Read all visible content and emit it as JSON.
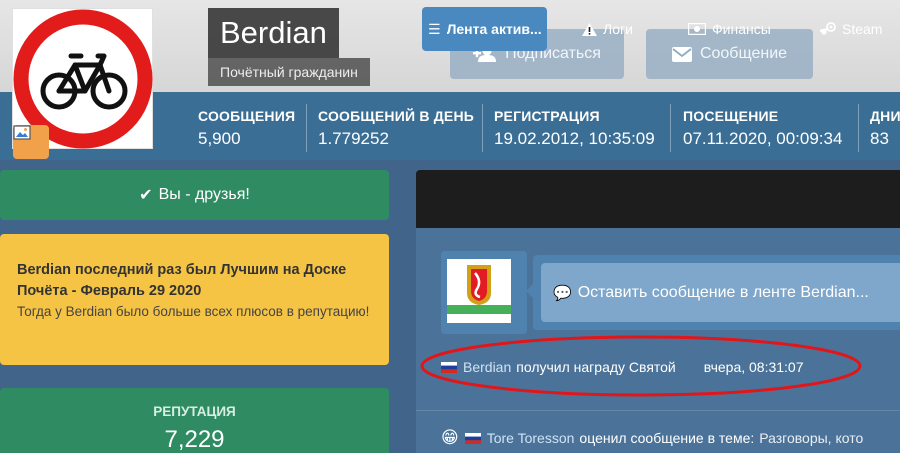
{
  "profile": {
    "name": "Berdian",
    "title": "Почётный гражданин",
    "follow_label": "Подписаться",
    "message_label": "Сообщение"
  },
  "stats": [
    {
      "label": "СООБЩЕНИЯ",
      "value": "5,900"
    },
    {
      "label": "СООБЩЕНИЙ В ДЕНЬ",
      "value": "1.779252"
    },
    {
      "label": "РЕГИСТРАЦИЯ",
      "value": "19.02.2012, 10:35:09"
    },
    {
      "label": "ПОСЕЩЕНИЕ",
      "value": "07.11.2020, 00:09:34"
    },
    {
      "label": "ДНИ",
      "value": "83"
    }
  ],
  "sidebar": {
    "friends_label": "Вы - друзья!",
    "notice_title": "Berdian последний раз был Лучшим на Доске Почёта - Февраль 29 2020",
    "notice_text": "Тогда у Berdian было больше всех плюсов в репутацию!",
    "reputation_label": "РЕПУТАЦИЯ",
    "reputation_value": "7,229"
  },
  "tabs": [
    {
      "label": "Лента актив...",
      "icon": "list-icon",
      "active": true
    },
    {
      "label": "Логи",
      "icon": "warning-icon",
      "active": false
    },
    {
      "label": "Финансы",
      "icon": "money-icon",
      "active": false
    },
    {
      "label": "Steam",
      "icon": "steam-icon",
      "active": false
    }
  ],
  "feed": {
    "compose_placeholder": "Оставить сообщение в ленте Berdian...",
    "award": {
      "user": "Berdian",
      "text": "получил награду Святой",
      "time": "вчера, 08:31:07"
    },
    "activity": {
      "user": "Tore Toresson",
      "text": "оценил сообщение в теме:",
      "topic": "Разговоры, кото"
    }
  },
  "colors": {
    "stats_bar": "#3b6e95",
    "friends_green": "#2f8c62",
    "notice_yellow": "#f6c444",
    "active_tab": "#4a89c0",
    "highlight_red": "#e0161b"
  }
}
